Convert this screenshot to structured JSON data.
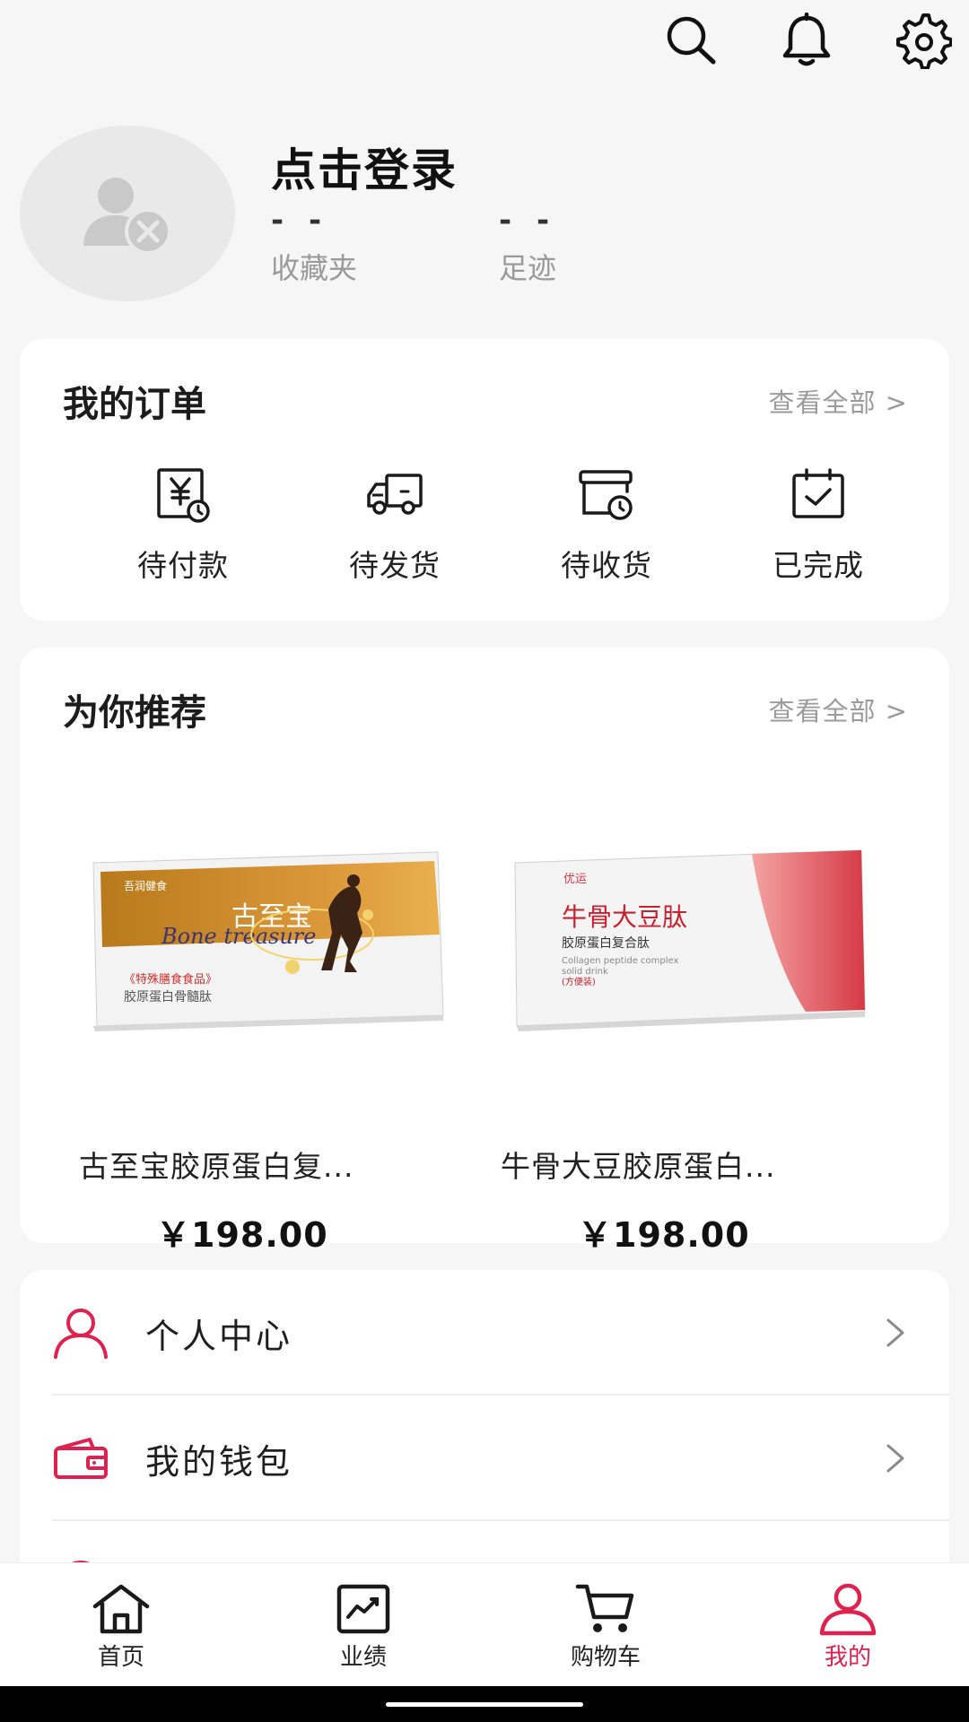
{
  "header": {
    "icons": [
      "search-icon",
      "bell-icon",
      "gear-icon"
    ]
  },
  "profile": {
    "login_label": "点击登录",
    "favorites": {
      "value": "- -",
      "label": "收藏夹"
    },
    "footprints": {
      "value": "- -",
      "label": "足迹"
    }
  },
  "orders": {
    "title": "我的订单",
    "see_all": "查看全部 >",
    "items": [
      {
        "label": "待付款",
        "icon": "payment-pending-icon"
      },
      {
        "label": "待发货",
        "icon": "delivery-truck-icon"
      },
      {
        "label": "待收货",
        "icon": "receipt-pending-icon"
      },
      {
        "label": "已完成",
        "icon": "calendar-check-icon"
      }
    ]
  },
  "recommend": {
    "title": "为你推荐",
    "see_all": "查看全部 >",
    "products": [
      {
        "name": "古至宝胶原蛋白复...",
        "price": "￥198.00",
        "box_brand": "吾润健食",
        "box_title": "古至宝",
        "box_script": "Bone treasure",
        "box_tag": "《特殊膳食食品》",
        "box_sub": "胶原蛋白骨髓肽"
      },
      {
        "name": "牛骨大豆胶原蛋白...",
        "price": "￥198.00",
        "box_brand": "优运",
        "box_title": "牛骨大豆肽",
        "box_sub": "胶原蛋白复合肽",
        "box_en1": "Collagen peptide complex",
        "box_en2": "solid drink",
        "box_tag": "(方便装)"
      }
    ]
  },
  "menu": {
    "items": [
      {
        "label": "个人中心",
        "icon": "user-icon"
      },
      {
        "label": "我的钱包",
        "icon": "wallet-icon"
      }
    ]
  },
  "tabbar": {
    "tabs": [
      {
        "label": "首页",
        "icon": "home-icon",
        "active": false
      },
      {
        "label": "业绩",
        "icon": "chart-icon",
        "active": false
      },
      {
        "label": "购物车",
        "icon": "cart-icon",
        "active": false
      },
      {
        "label": "我的",
        "icon": "profile-icon",
        "active": true
      }
    ]
  },
  "colors": {
    "accent": "#e0204e",
    "background": "#f6f6f6",
    "muted": "#9b9b9b"
  }
}
